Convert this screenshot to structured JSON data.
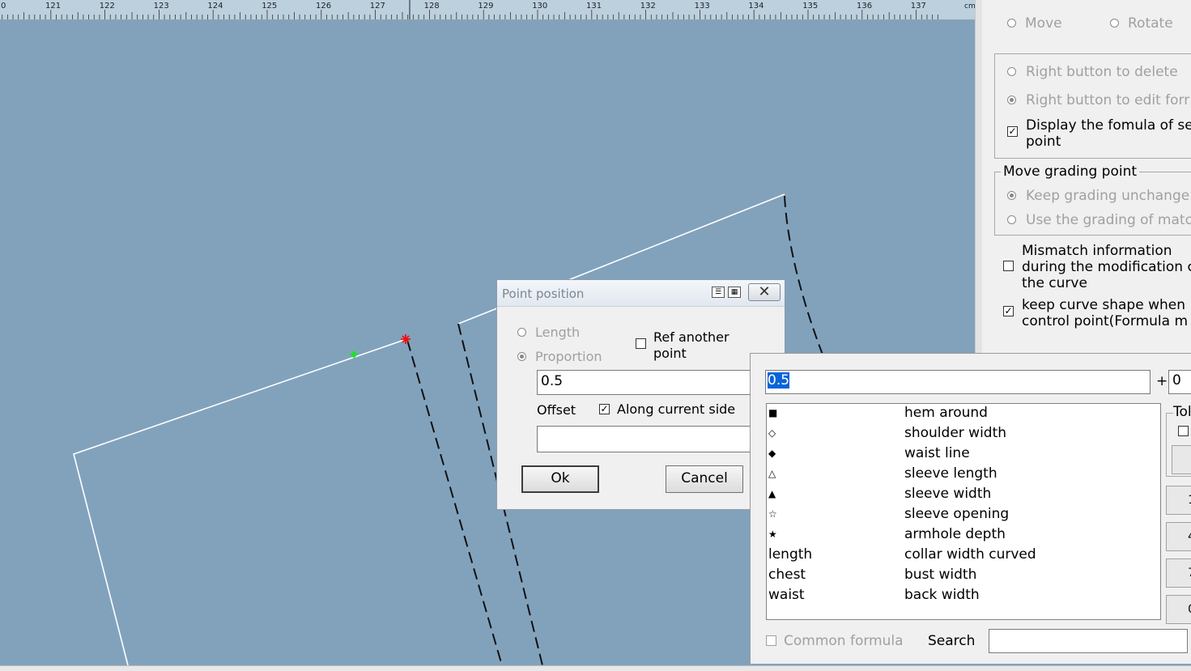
{
  "ruler": {
    "ticks": [
      "0",
      "121",
      "122",
      "123",
      "124",
      "125",
      "126",
      "127",
      "128",
      "129",
      "130",
      "131",
      "132",
      "133",
      "134",
      "135",
      "136",
      "137"
    ],
    "unit": "cm"
  },
  "side_panel": {
    "move_label": "Move",
    "rotate_label": "Rotate",
    "right_delete_label": "Right button to delete",
    "right_edit_label": "Right button to edit forr",
    "display_formula_line1": "Display the fomula of se",
    "display_formula_line2": "point",
    "move_grading_title": "Move grading point",
    "keep_grading_label": "Keep grading unchange",
    "use_grading_label": "Use the grading of matc",
    "mismatch_line1": "Mismatch information",
    "mismatch_line2": "during the modification c",
    "mismatch_line3": "the curve",
    "keep_shape_line1": "keep curve shape when",
    "keep_shape_line2": "control point(Formula m"
  },
  "dialog": {
    "title": "Point position",
    "length_label": "Length",
    "proportion_label": "Proportion",
    "ref_line1": "Ref another",
    "ref_line2": "point",
    "value": "0.5",
    "offset_label": "Offset",
    "along_label": "Along current side",
    "offset_value": "",
    "ok_label": "Ok",
    "cancel_label": "Cancel"
  },
  "formula_panel": {
    "formula_value": "0.5",
    "plus_sign": "+",
    "plus_value": "0",
    "tol_label": "Tol",
    "items": [
      {
        "symbol": "■",
        "name": "hem around"
      },
      {
        "symbol": "◇",
        "name": "shoulder width"
      },
      {
        "symbol": "◆",
        "name": "waist line"
      },
      {
        "symbol": "△",
        "name": "sleeve length"
      },
      {
        "symbol": "▲",
        "name": "sleeve width"
      },
      {
        "symbol": "☆",
        "name": "sleeve opening"
      },
      {
        "symbol": "★",
        "name": "armhole depth"
      },
      {
        "symbol": "length",
        "name": "collar width curved"
      },
      {
        "symbol": "chest",
        "name": "bust width"
      },
      {
        "symbol": "waist",
        "name": "back width"
      }
    ],
    "keypad": [
      "1",
      "4",
      "7",
      "0"
    ],
    "common_formula_label": "Common formula",
    "search_label": "Search",
    "search_value": ""
  }
}
